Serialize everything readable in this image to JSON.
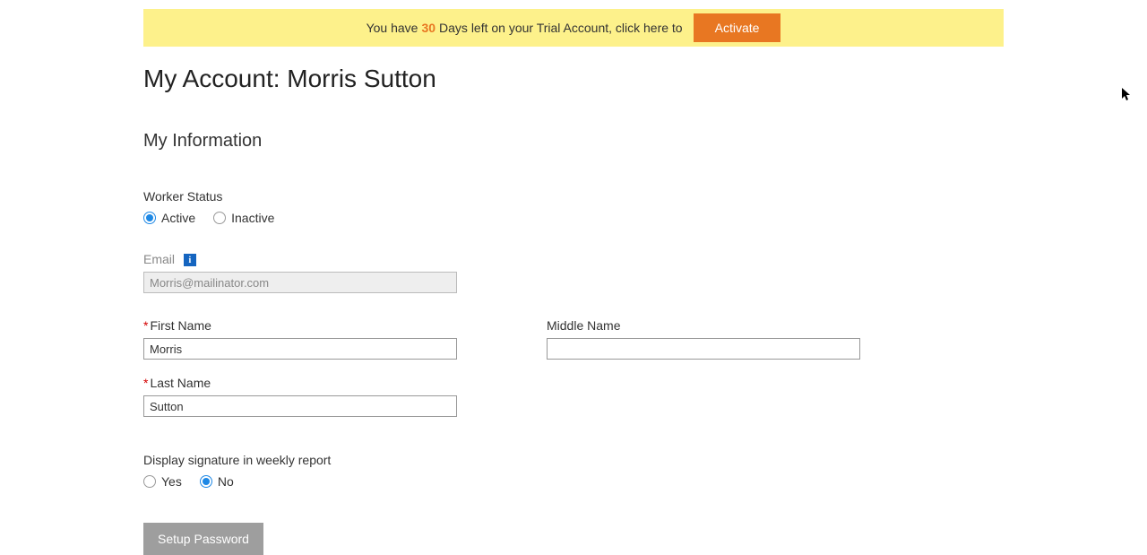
{
  "banner": {
    "pre_text": "You have",
    "days": "30",
    "post_text": "Days left on your Trial Account, click here to",
    "activate_label": "Activate"
  },
  "page": {
    "title": "My Account: Morris Sutton",
    "section_title": "My Information"
  },
  "worker_status": {
    "label": "Worker Status",
    "active_label": "Active",
    "inactive_label": "Inactive",
    "selected": "active"
  },
  "email": {
    "label": "Email",
    "value": "Morris@mailinator.com",
    "info_icon": "i"
  },
  "first_name": {
    "label": "First Name",
    "value": "Morris"
  },
  "middle_name": {
    "label": "Middle Name",
    "value": ""
  },
  "last_name": {
    "label": "Last Name",
    "value": "Sutton"
  },
  "signature": {
    "label": "Display signature in weekly report",
    "yes_label": "Yes",
    "no_label": "No",
    "selected": "no"
  },
  "setup_password_label": "Setup Password"
}
